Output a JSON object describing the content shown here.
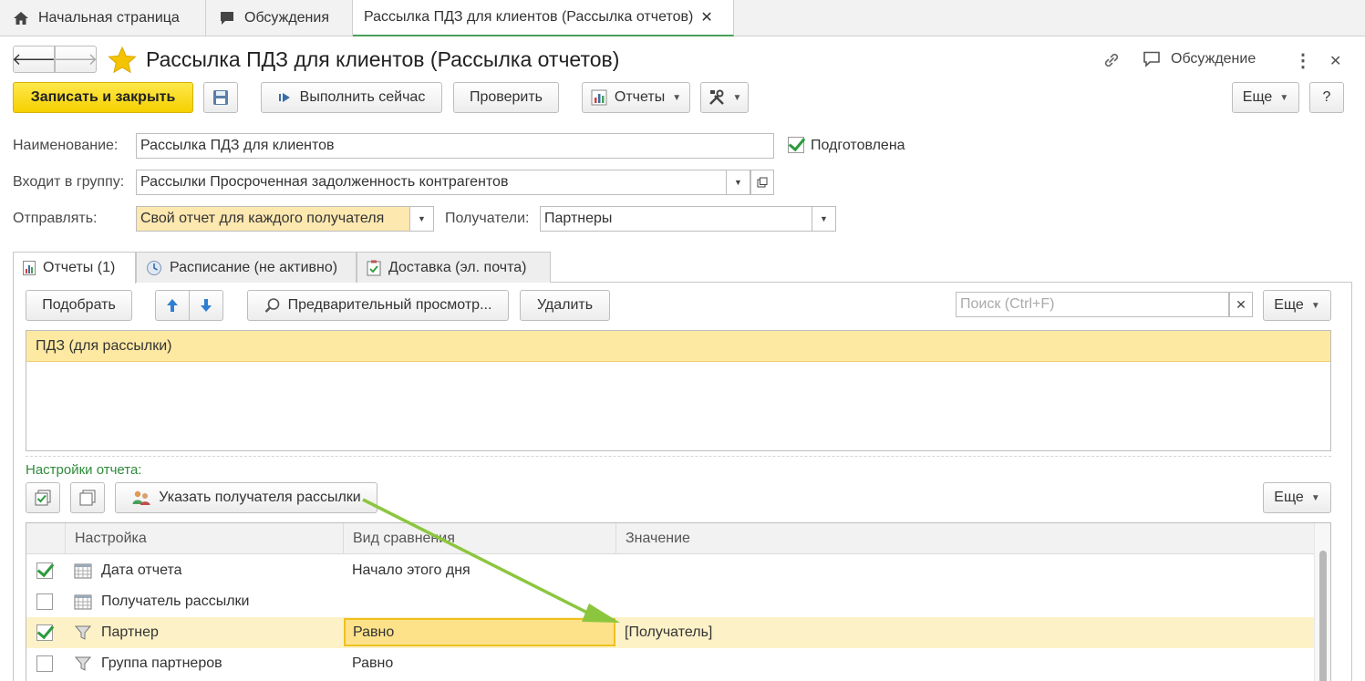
{
  "tabs": {
    "home": "Начальная страница",
    "discussions": "Обсуждения",
    "current": "Рассылка ПДЗ для клиентов (Рассылка отчетов)",
    "close": "✕"
  },
  "header": {
    "back": "🡐",
    "forward": "🡒",
    "title": "Рассылка ПДЗ для клиентов (Рассылка отчетов)",
    "discussion": "Обсуждение",
    "more": "⋮",
    "close": "✕"
  },
  "toolbar": {
    "save_close": "Записать и закрыть",
    "run_now": "Выполнить сейчас",
    "check": "Проверить",
    "reports": "Отчеты",
    "more": "Еще",
    "help": "?"
  },
  "form": {
    "name_label": "Наименование:",
    "name_value": "Рассылка ПДЗ для клиентов",
    "prepared_label": "Подготовлена",
    "group_label": "Входит в группу:",
    "group_value": "Рассылки Просроченная задолженность контрагентов",
    "send_label": "Отправлять:",
    "send_value": "Свой отчет для каждого получателя",
    "recipients_label": "Получатели:",
    "recipients_value": "Партнеры"
  },
  "form_tabs": {
    "reports": "Отчеты (1)",
    "schedule": "Расписание (не активно)",
    "delivery": "Доставка (эл. почта)"
  },
  "reports_panel": {
    "pick": "Подобрать",
    "preview": "Предварительный просмотр...",
    "delete": "Удалить",
    "search_placeholder": "Поиск (Ctrl+F)",
    "search_clear": "✕",
    "more": "Еще",
    "items": [
      "ПДЗ (для рассылки)"
    ]
  },
  "settings": {
    "section_label": "Настройки отчета:",
    "set_recipient": "Указать получателя рассылки",
    "more": "Еще",
    "columns": [
      "Настройка",
      "Вид сравнения",
      "Значение"
    ],
    "rows": [
      {
        "checked": true,
        "name": "Дата отчета",
        "comparison": "Начало этого дня",
        "value": ""
      },
      {
        "checked": false,
        "name": "Получатель рассылки",
        "comparison": "",
        "value": ""
      },
      {
        "checked": true,
        "name": "Партнер",
        "comparison": "Равно",
        "value": "[Получатель]"
      },
      {
        "checked": false,
        "name": "Группа партнеров",
        "comparison": "Равно",
        "value": ""
      }
    ]
  },
  "colors": {
    "accent_green": "#2e8b3a",
    "yellow_button": "#f5d000",
    "selected_row": "#fdf1c7",
    "annotation_arrow": "#8cc63f"
  }
}
